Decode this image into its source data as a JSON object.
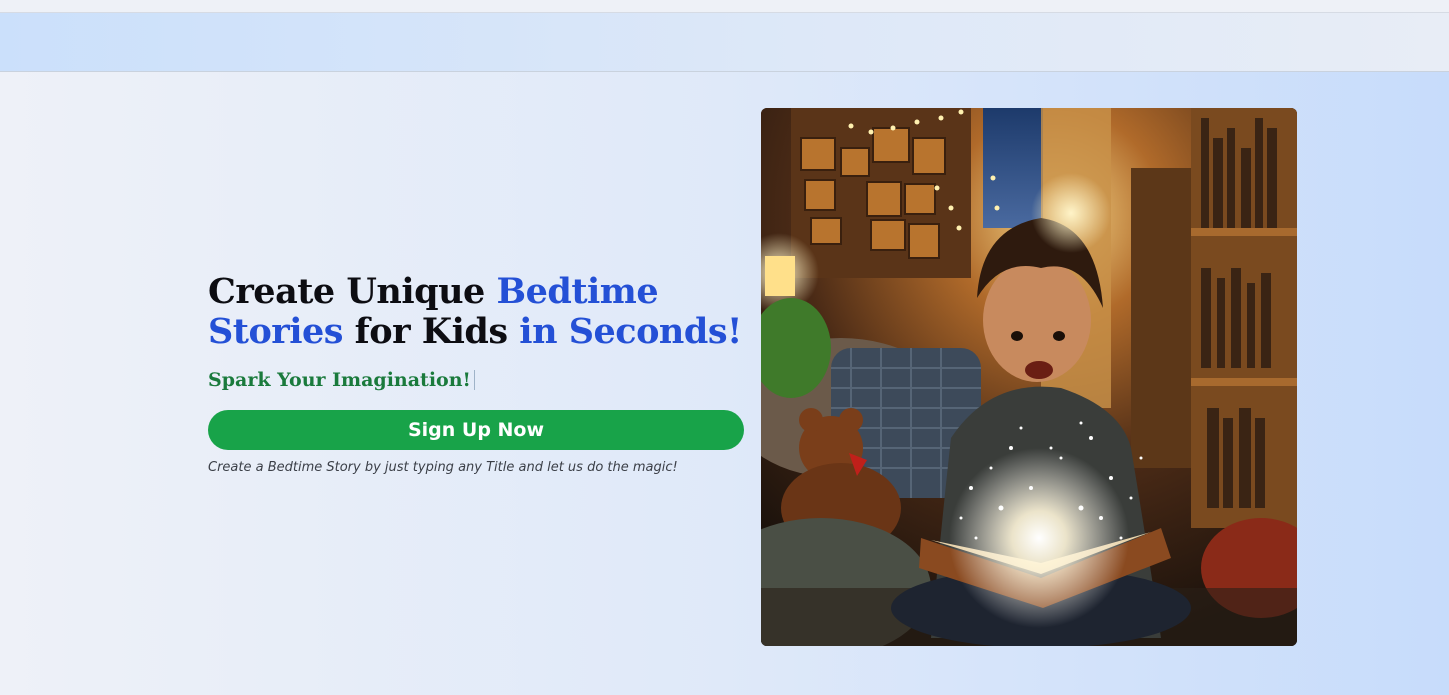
{
  "headline": {
    "part1": "Create Unique ",
    "part2": "Bedtime",
    "part3": "Stories",
    "part4": " for Kids ",
    "part5": "in Seconds!"
  },
  "subheadline": "Spark Your Imagination!",
  "signup_button": "Sign Up Now",
  "caption": "Create a Bedtime Story by just typing any Title and let us do the magic!",
  "colors": {
    "accent_blue": "#2450d6",
    "green": "#18a349",
    "subhead_green": "#1a7a3c"
  },
  "hero_image": {
    "subject": "boy-reading-glowing-book"
  }
}
